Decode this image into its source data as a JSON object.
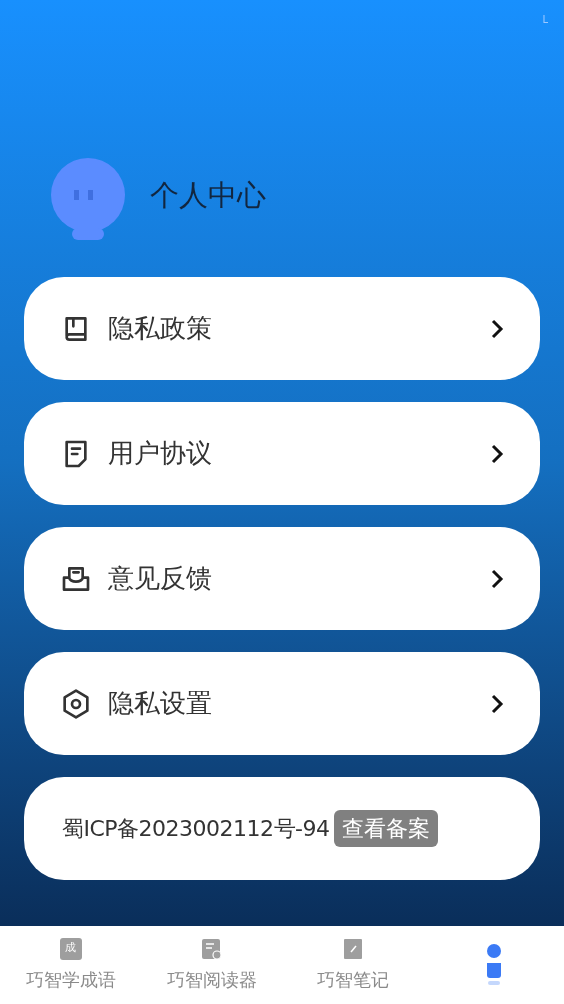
{
  "status_bar": {
    "indicator": "L"
  },
  "profile": {
    "title": "个人中心"
  },
  "menu": [
    {
      "kind": "book",
      "label": "隐私政策"
    },
    {
      "kind": "document",
      "label": "用户协议"
    },
    {
      "kind": "inbox",
      "label": "意见反馈"
    },
    {
      "kind": "gear",
      "label": "隐私设置"
    }
  ],
  "license": {
    "text": "蜀ICP备2023002112号-94",
    "button": "查看备案"
  },
  "tabs": [
    {
      "kind": "idiom",
      "label": "巧智学成语",
      "icon_text": "成",
      "selected": false
    },
    {
      "kind": "reader",
      "label": "巧智阅读器",
      "selected": false
    },
    {
      "kind": "notes",
      "label": "巧智笔记",
      "selected": false
    },
    {
      "kind": "person",
      "selected": true
    }
  ]
}
